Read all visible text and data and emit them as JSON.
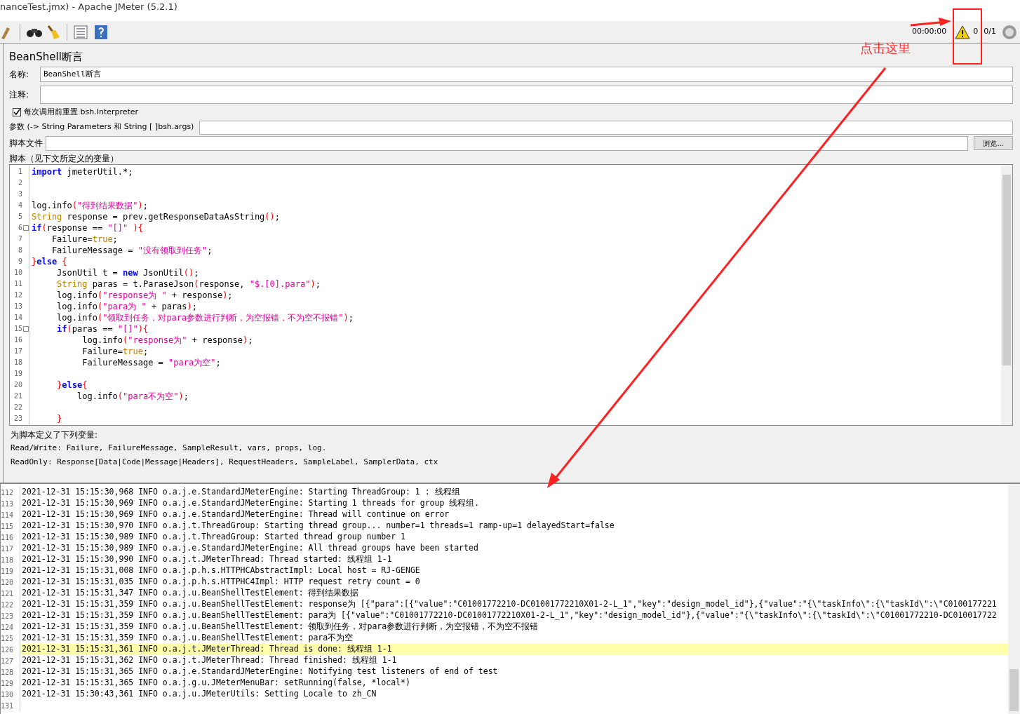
{
  "window": {
    "title": "nanceTest.jmx) - Apache JMeter (5.2.1)"
  },
  "status": {
    "elapsed": "00:00:00",
    "warnings": "0",
    "threads": "0/1"
  },
  "panel": {
    "title": "BeanShell断言",
    "name_label": "名称:",
    "name_value": "BeanShell断言",
    "comment_label": "注释:",
    "reset": {
      "label": "每次调用前重置 bsh.Interpreter",
      "checked": true
    },
    "params_label": "参数 (-> String Parameters 和 String [ ]bsh.args)",
    "file_label": "脚本文件",
    "browse": "浏览...",
    "script_label": "脚本（见下文所定义的变量）"
  },
  "script": [
    {
      "n": "1",
      "fold": false,
      "tokens": [
        {
          "kind": "keyword",
          "text": "import"
        },
        {
          "kind": "plain",
          "text": " jmeterUtil.*;"
        }
      ]
    },
    {
      "n": "2",
      "fold": false
    },
    {
      "n": "3",
      "fold": false
    },
    {
      "n": "4",
      "fold": false,
      "tokens": [
        {
          "kind": "plain",
          "text": "log.info"
        },
        {
          "kind": "paren",
          "text": "("
        },
        {
          "kind": "string",
          "text": "\"得到结果数据\""
        },
        {
          "kind": "paren",
          "text": ")"
        },
        {
          "kind": "plain",
          "text": ";"
        }
      ]
    },
    {
      "n": "5",
      "fold": false,
      "tokens": [
        {
          "kind": "type",
          "text": "String"
        },
        {
          "kind": "plain",
          "text": " response = prev.getResponseDataAsString"
        },
        {
          "kind": "paren",
          "text": "()"
        },
        {
          "kind": "plain",
          "text": ";"
        }
      ]
    },
    {
      "n": "6",
      "fold": true,
      "tokens": [
        {
          "kind": "keyword",
          "text": "if"
        },
        {
          "kind": "paren",
          "text": "("
        },
        {
          "kind": "plain",
          "text": "response == "
        },
        {
          "kind": "string",
          "text": "\"[]\""
        },
        {
          "kind": "paren",
          "text": " ){"
        }
      ]
    },
    {
      "n": "7",
      "fold": false,
      "tokens": [
        {
          "kind": "plain",
          "text": "    Failure="
        },
        {
          "kind": "type",
          "text": "true"
        },
        {
          "kind": "plain",
          "text": ";"
        }
      ]
    },
    {
      "n": "8",
      "fold": false,
      "tokens": [
        {
          "kind": "plain",
          "text": "    FailureMessage = "
        },
        {
          "kind": "string",
          "text": "\"没有领取到任务\""
        },
        {
          "kind": "plain",
          "text": ";"
        }
      ]
    },
    {
      "n": "9",
      "fold": false,
      "tokens": [
        {
          "kind": "paren",
          "text": "}"
        },
        {
          "kind": "keyword",
          "text": "else"
        },
        {
          "kind": "paren",
          "text": " {"
        }
      ]
    },
    {
      "n": "10",
      "fold": false,
      "tokens": [
        {
          "kind": "plain",
          "text": "     JsonUtil t = "
        },
        {
          "kind": "keyword",
          "text": "new"
        },
        {
          "kind": "plain",
          "text": " JsonUtil"
        },
        {
          "kind": "paren",
          "text": "()"
        },
        {
          "kind": "plain",
          "text": ";"
        }
      ]
    },
    {
      "n": "11",
      "fold": false,
      "tokens": [
        {
          "kind": "type",
          "text": "     String"
        },
        {
          "kind": "plain",
          "text": " paras = t.ParaseJson"
        },
        {
          "kind": "paren",
          "text": "("
        },
        {
          "kind": "plain",
          "text": "response, "
        },
        {
          "kind": "string",
          "text": "\"$.[0].para\""
        },
        {
          "kind": "paren",
          "text": ")"
        },
        {
          "kind": "plain",
          "text": ";"
        }
      ]
    },
    {
      "n": "12",
      "fold": false,
      "tokens": [
        {
          "kind": "plain",
          "text": "     log.info"
        },
        {
          "kind": "paren",
          "text": "("
        },
        {
          "kind": "string",
          "text": "\"response为 \""
        },
        {
          "kind": "plain",
          "text": " + response"
        },
        {
          "kind": "paren",
          "text": ")"
        },
        {
          "kind": "plain",
          "text": ";"
        }
      ]
    },
    {
      "n": "13",
      "fold": false,
      "tokens": [
        {
          "kind": "plain",
          "text": "     log.info"
        },
        {
          "kind": "paren",
          "text": "("
        },
        {
          "kind": "string",
          "text": "\"para为 \""
        },
        {
          "kind": "plain",
          "text": " + paras"
        },
        {
          "kind": "paren",
          "text": ")"
        },
        {
          "kind": "plain",
          "text": ";"
        }
      ]
    },
    {
      "n": "14",
      "fold": false,
      "tokens": [
        {
          "kind": "plain",
          "text": "     log.info"
        },
        {
          "kind": "paren",
          "text": "("
        },
        {
          "kind": "string",
          "text": "\"领取到任务，对para参数进行判断，为空报错，不为空不报错\""
        },
        {
          "kind": "paren",
          "text": ")"
        },
        {
          "kind": "plain",
          "text": ";"
        }
      ]
    },
    {
      "n": "15",
      "fold": true,
      "tokens": [
        {
          "kind": "keyword",
          "text": "     if"
        },
        {
          "kind": "paren",
          "text": "("
        },
        {
          "kind": "plain",
          "text": "paras == "
        },
        {
          "kind": "string",
          "text": "\"[]\""
        },
        {
          "kind": "paren",
          "text": "){"
        }
      ]
    },
    {
      "n": "16",
      "fold": false,
      "tokens": [
        {
          "kind": "plain",
          "text": "          log.info"
        },
        {
          "kind": "paren",
          "text": "("
        },
        {
          "kind": "string",
          "text": "\"response为\""
        },
        {
          "kind": "plain",
          "text": " + response"
        },
        {
          "kind": "paren",
          "text": ")"
        },
        {
          "kind": "plain",
          "text": ";"
        }
      ]
    },
    {
      "n": "17",
      "fold": false,
      "tokens": [
        {
          "kind": "plain",
          "text": "          Failure="
        },
        {
          "kind": "type",
          "text": "true"
        },
        {
          "kind": "plain",
          "text": ";"
        }
      ]
    },
    {
      "n": "18",
      "fold": false,
      "tokens": [
        {
          "kind": "plain",
          "text": "          FailureMessage = "
        },
        {
          "kind": "string",
          "text": "\"para为空\""
        },
        {
          "kind": "plain",
          "text": ";"
        }
      ]
    },
    {
      "n": "19",
      "fold": false
    },
    {
      "n": "20",
      "fold": false,
      "tokens": [
        {
          "kind": "paren",
          "text": "     }"
        },
        {
          "kind": "keyword",
          "text": "else"
        },
        {
          "kind": "paren",
          "text": "{"
        }
      ]
    },
    {
      "n": "21",
      "fold": false,
      "tokens": [
        {
          "kind": "plain",
          "text": "         log.info"
        },
        {
          "kind": "paren",
          "text": "("
        },
        {
          "kind": "string",
          "text": "\"para不为空\""
        },
        {
          "kind": "paren",
          "text": ")"
        },
        {
          "kind": "plain",
          "text": ";"
        }
      ]
    },
    {
      "n": "22",
      "fold": false
    },
    {
      "n": "23",
      "fold": false,
      "tokens": [
        {
          "kind": "paren",
          "text": "     }"
        }
      ]
    }
  ],
  "variables": {
    "title": "为脚本定义了下列变量:",
    "read_write": "Read/Write:  Failure, FailureMessage, SampleResult, vars, props, log.",
    "read_only": "ReadOnly:  Response[Data|Code|Message|Headers], RequestHeaders, SampleLabel, SamplerData, ctx"
  },
  "log": [
    {
      "n": "112",
      "selected": false,
      "text": "2021-12-31 15:15:30,968 INFO o.a.j.e.StandardJMeterEngine: Starting ThreadGroup: 1 : 线程组"
    },
    {
      "n": "113",
      "selected": false,
      "text": "2021-12-31 15:15:30,969 INFO o.a.j.e.StandardJMeterEngine: Starting 1 threads for group 线程组."
    },
    {
      "n": "114",
      "selected": false,
      "text": "2021-12-31 15:15:30,969 INFO o.a.j.e.StandardJMeterEngine: Thread will continue on error"
    },
    {
      "n": "115",
      "selected": false,
      "text": "2021-12-31 15:15:30,970 INFO o.a.j.t.ThreadGroup: Starting thread group... number=1 threads=1 ramp-up=1 delayedStart=false"
    },
    {
      "n": "116",
      "selected": false,
      "text": "2021-12-31 15:15:30,989 INFO o.a.j.t.ThreadGroup: Started thread group number 1"
    },
    {
      "n": "117",
      "selected": false,
      "text": "2021-12-31 15:15:30,989 INFO o.a.j.e.StandardJMeterEngine: All thread groups have been started"
    },
    {
      "n": "118",
      "selected": false,
      "text": "2021-12-31 15:15:30,990 INFO o.a.j.t.JMeterThread: Thread started: 线程组 1-1"
    },
    {
      "n": "119",
      "selected": false,
      "text": "2021-12-31 15:15:31,008 INFO o.a.j.p.h.s.HTTPHCAbstractImpl: Local host = RJ-GENGE"
    },
    {
      "n": "120",
      "selected": false,
      "text": "2021-12-31 15:15:31,035 INFO o.a.j.p.h.s.HTTPHC4Impl: HTTP request retry count = 0"
    },
    {
      "n": "121",
      "selected": false,
      "text": "2021-12-31 15:15:31,347 INFO o.a.j.u.BeanShellTestElement: 得到结果数据"
    },
    {
      "n": "122",
      "selected": false,
      "text": "2021-12-31 15:15:31,359 INFO o.a.j.u.BeanShellTestElement: response为 [{\"para\":[{\"value\":\"C01001772210-DC01001772210X01-2-L_1\",\"key\":\"design_model_id\"},{\"value\":\"{\\\"taskInfo\\\":{\\\"taskId\\\":\\\"C0100177221"
    },
    {
      "n": "123",
      "selected": false,
      "text": "2021-12-31 15:15:31,359 INFO o.a.j.u.BeanShellTestElement: para为 [{\"value\":\"C01001772210-DC01001772210X01-2-L_1\",\"key\":\"design_model_id\"},{\"value\":\"{\\\"taskInfo\\\":{\\\"taskId\\\":\\\"C01001772210-DC010017722"
    },
    {
      "n": "124",
      "selected": false,
      "text": "2021-12-31 15:15:31,359 INFO o.a.j.u.BeanShellTestElement: 领取到任务，对para参数进行判断，为空报错，不为空不报错"
    },
    {
      "n": "125",
      "selected": false,
      "text": "2021-12-31 15:15:31,359 INFO o.a.j.u.BeanShellTestElement: para不为空"
    },
    {
      "n": "126",
      "selected": true,
      "text": "2021-12-31 15:15:31,361 INFO o.a.j.t.JMeterThread: Thread is done: 线程组 1-1"
    },
    {
      "n": "127",
      "selected": false,
      "text": "2021-12-31 15:15:31,362 INFO o.a.j.t.JMeterThread: Thread finished: 线程组 1-1"
    },
    {
      "n": "128",
      "selected": false,
      "text": "2021-12-31 15:15:31,365 INFO o.a.j.e.StandardJMeterEngine: Notifying test listeners of end of test"
    },
    {
      "n": "129",
      "selected": false,
      "text": "2021-12-31 15:15:31,365 INFO o.a.j.g.u.JMeterMenuBar: setRunning(false, *local*)"
    },
    {
      "n": "130",
      "selected": false,
      "text": "2021-12-31 15:30:43,361 INFO o.a.j.u.JMeterUtils: Setting Locale to zh_CN"
    },
    {
      "n": "131",
      "selected": false
    }
  ],
  "annotation": {
    "text": "点击这里"
  }
}
